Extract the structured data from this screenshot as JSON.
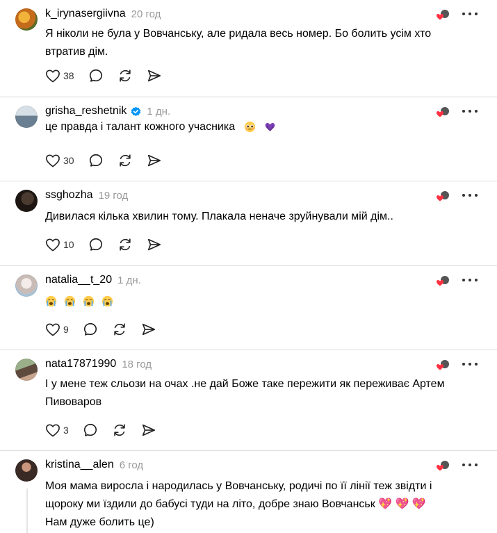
{
  "comments": [
    {
      "username": "k_irynasergiivna",
      "time": "20 год",
      "text": "Я ніколи не була у Вовчанську, але ридала весь номер. Бо болить усім хто втратив дім.",
      "likes": "38",
      "verified": false,
      "avatar_color": "#b5702a"
    },
    {
      "username": "grisha_reshetnik",
      "time": "1 дн.",
      "text": "це правда і талант кожного учасника",
      "emoji_tail": [
        "pleading-face",
        "purple-heart-hands"
      ],
      "likes": "30",
      "verified": true,
      "avatar_color": "#6a8ea8"
    },
    {
      "username": "ssghozha",
      "time": "19 год",
      "text": "Дивилася кілька хвилин тому. Плакала неначе зруйнували мій дім..",
      "likes": "10",
      "verified": false,
      "avatar_color": "#2b211c"
    },
    {
      "username": "natalia__t_20",
      "time": "1 дн.",
      "text": "",
      "emoji_row": [
        "crying-face",
        "crying-face",
        "crying-face",
        "crying-face"
      ],
      "likes": "9",
      "verified": false,
      "avatar_color": "#c7b9b5"
    },
    {
      "username": "nata17871990",
      "time": "18 год",
      "text": "І у мене теж сльози на очах .не дай Боже таке пережити як переживає Артем Пивоваров",
      "likes": "3",
      "verified": false,
      "avatar_color": "#6b7a5a"
    },
    {
      "username": "kristina__alen",
      "time": "6 год",
      "text": "Моя мама виросла і народилась у Вовчанську, родичі по її лінії теж звідти і щороку ми їздили до бабусі туди на літо, добре знаю Вовчанськ 💖 💖 💖  Нам дуже болить це)",
      "likes": "",
      "verified": false,
      "avatar_color": "#3a2a26"
    }
  ],
  "icons": {
    "like": "heart-outline-icon",
    "reply": "reply-bubble-icon",
    "repost": "repost-icon",
    "share": "send-icon",
    "more": "more-dots-icon",
    "verified": "verified-badge-icon",
    "liked_by_author": "liked-by-author-icon"
  },
  "colors": {
    "verified": "#0095f6",
    "heart_red": "#ff3040",
    "divider": "#dbdbdb",
    "muted": "#999999"
  }
}
